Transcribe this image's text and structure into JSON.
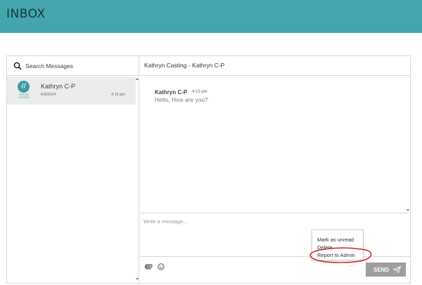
{
  "header": {
    "title": "INBOX"
  },
  "search": {
    "placeholder": "Search Messages"
  },
  "conversations": [
    {
      "name": "Kathryn C-P",
      "date": "6/9/2024",
      "time": "4:15 pm",
      "logo_text": "VIRTUAL CASTING"
    }
  ],
  "thread": {
    "title": "Kathryn Casting - Kathryn C-P",
    "messages": [
      {
        "sender": "Kathryn C-P",
        "time": "4:15 pm",
        "text": "Hello, How are you?"
      }
    ]
  },
  "compose": {
    "placeholder": "Write a message..."
  },
  "toolbar": {
    "more": "...",
    "send_label": "SEND"
  },
  "menu": {
    "items": [
      "Mark as unread",
      "Delete",
      "Report to Admin"
    ]
  },
  "colors": {
    "header": "#44a5ae",
    "send": "#9e9e9e",
    "annotation": "#d0322e"
  }
}
